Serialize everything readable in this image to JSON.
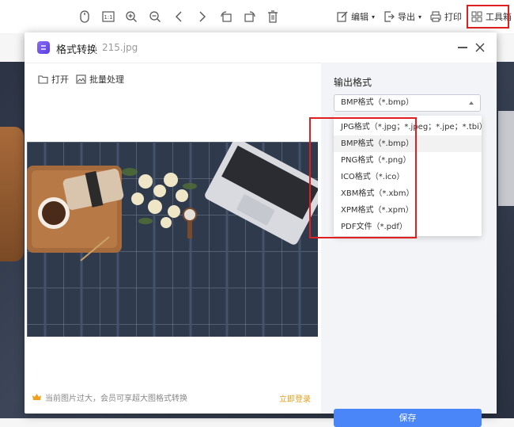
{
  "toolbar": {
    "edit_label": "编辑",
    "export_label": "导出",
    "print_label": "打印",
    "toolbox_label": "工具箱",
    "icons": [
      "mouse-icon",
      "actual-size-icon",
      "zoom-in-icon",
      "zoom-out-icon",
      "prev-icon",
      "next-icon",
      "rotate-left-icon",
      "rotate-right-icon",
      "delete-icon"
    ]
  },
  "dialog": {
    "title": "格式转换",
    "filename": "215.jpg",
    "left": {
      "open_label": "打开",
      "batch_label": "批量处理",
      "footer_note": "当前图片过大，会员可享超大图格式转换",
      "login_label": "立即登录"
    },
    "right": {
      "output_label": "输出格式",
      "selected_format": "BMP格式（*.bmp）",
      "options": [
        "JPG格式（*.jpg；*.jpeg；*.jpe；*.tbi）",
        "BMP格式（*.bmp）",
        "PNG格式（*.png）",
        "ICO格式（*.ico）",
        "XBM格式（*.xbm）",
        "XPM格式（*.xpm）",
        "PDF文件（*.pdf）"
      ],
      "save_label": "保存"
    }
  },
  "colors": {
    "accent": "#4a86f7",
    "highlight": "#e02020",
    "link": "#e0a020"
  }
}
